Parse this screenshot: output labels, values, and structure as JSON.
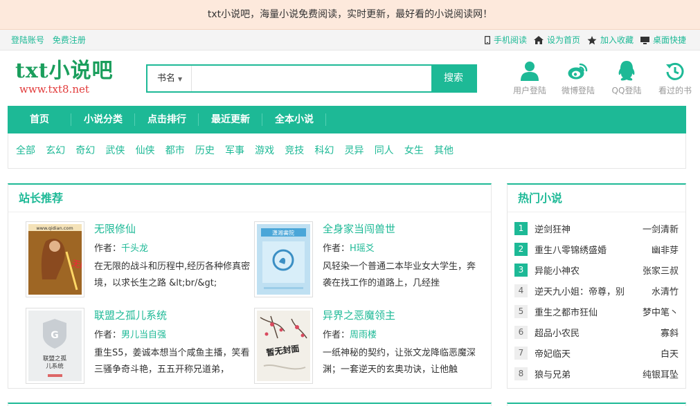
{
  "notice": "txt小说吧，海量小说免费阅读，实时更新，最好看的小说阅读网！",
  "topbar": {
    "login": "登陆账号",
    "register": "免费注册",
    "mobile": "手机阅读",
    "homepage": "设为首页",
    "favorite": "加入收藏",
    "desktop": "桌面快捷"
  },
  "logo": {
    "title": "txt小说吧",
    "url": "www.txt8.net"
  },
  "search": {
    "type": "书名",
    "placeholder": "",
    "button": "搜索"
  },
  "user_buttons": [
    {
      "label": "用户登陆",
      "icon": "user-icon"
    },
    {
      "label": "微博登陆",
      "icon": "weibo-icon"
    },
    {
      "label": "QQ登陆",
      "icon": "qq-icon"
    },
    {
      "label": "看过的书",
      "icon": "history-icon"
    }
  ],
  "nav": [
    "首页",
    "小说分类",
    "点击排行",
    "最近更新",
    "全本小说"
  ],
  "categories": [
    "全部",
    "玄幻",
    "奇幻",
    "武侠",
    "仙侠",
    "都市",
    "历史",
    "军事",
    "游戏",
    "竞技",
    "科幻",
    "灵异",
    "同人",
    "女生",
    "其他"
  ],
  "recommend": {
    "title": "站长推荐",
    "author_prefix": "作者：",
    "books": [
      {
        "name": "无限修仙",
        "author": "千头龙",
        "desc": "在无限的战斗和历程中,经历各种修真密境，以求长生之路 &lt;br/&gt;",
        "cover_text": "www.qidian.com"
      },
      {
        "name": "全身家当闯兽世",
        "author": "H瑶爻",
        "desc": "风轻染一个普通二本毕业女大学生，奔袭在找工作的道路上，几经挫",
        "cover_text": "潇湘書院"
      },
      {
        "name": "联盟之孤儿系统",
        "author": "男儿当自强",
        "desc": "重生S5，姜诚本想当个咸鱼主播，笑看三骚争奇斗艳，五五开称兄道弟，",
        "cover_text": "联盟之孤儿系统"
      },
      {
        "name": "异界之恶魔领主",
        "author": "周雨楼",
        "desc": "一纸神秘的契约，让张文龙降临恶魔深渊；一套逆天的玄奥功诀，让他触",
        "cover_text": "暂无封面"
      }
    ]
  },
  "hot": {
    "title": "热门小说",
    "items": [
      {
        "rank": "1",
        "title": "逆剑狂神",
        "author": "一剑清新"
      },
      {
        "rank": "2",
        "title": "重生八零锦绣盛婚",
        "author": "幽非芽"
      },
      {
        "rank": "3",
        "title": "异能小神农",
        "author": "张家三叔"
      },
      {
        "rank": "4",
        "title": "逆天九小姐：帝尊，别",
        "author": "水清竹"
      },
      {
        "rank": "5",
        "title": "重生之都市狂仙",
        "author": "梦中笔丶"
      },
      {
        "rank": "6",
        "title": "超品小农民",
        "author": "寡斜"
      },
      {
        "rank": "7",
        "title": "帝妃临天",
        "author": "白天"
      },
      {
        "rank": "8",
        "title": "狼与兄弟",
        "author": "纯银耳坠"
      }
    ]
  },
  "colors": {
    "accent": "#1db996",
    "notice_bg": "#fde9dc",
    "logo_green": "#1a9e5c",
    "logo_red": "#e23b3b"
  }
}
